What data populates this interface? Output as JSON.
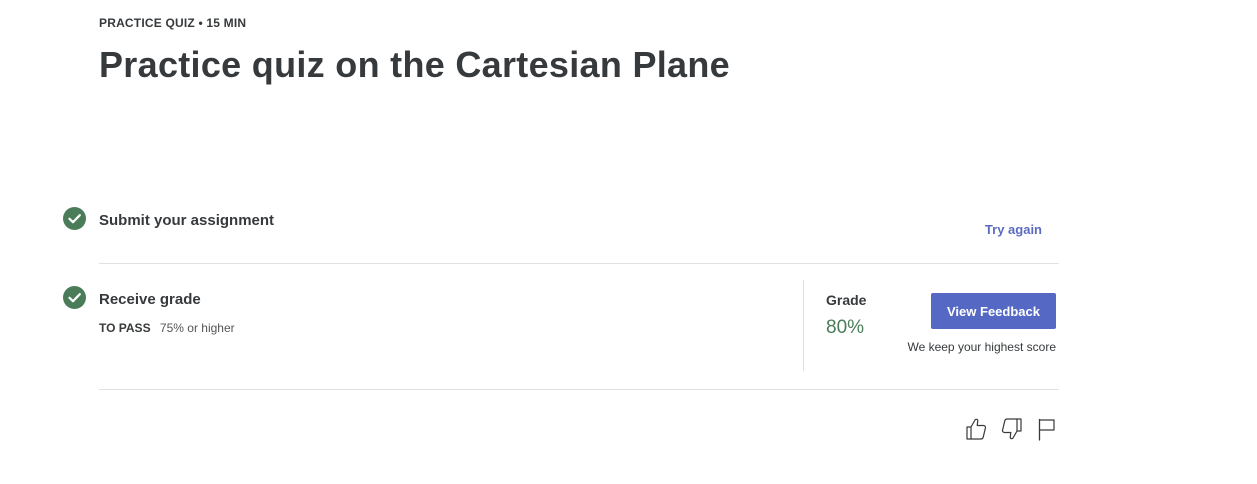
{
  "header": {
    "eyebrow": "PRACTICE QUIZ • 15 MIN",
    "title": "Practice quiz on the Cartesian Plane"
  },
  "steps": [
    {
      "title": "Submit your assignment",
      "status": "completed",
      "action_label": "Try again"
    },
    {
      "title": "Receive grade",
      "status": "completed",
      "pass_label": "TO PASS",
      "pass_value": "75% or higher"
    }
  ],
  "grade": {
    "label": "Grade",
    "value": "80%",
    "button_label": "View Feedback",
    "note": "We keep your highest score"
  },
  "feedback_icons": [
    "thumbs-up-icon",
    "thumbs-down-icon",
    "flag-icon"
  ],
  "colors": {
    "accent": "#5568c4",
    "link": "#5c6bc0",
    "success": "#4a7c59",
    "text": "#373a3c"
  }
}
